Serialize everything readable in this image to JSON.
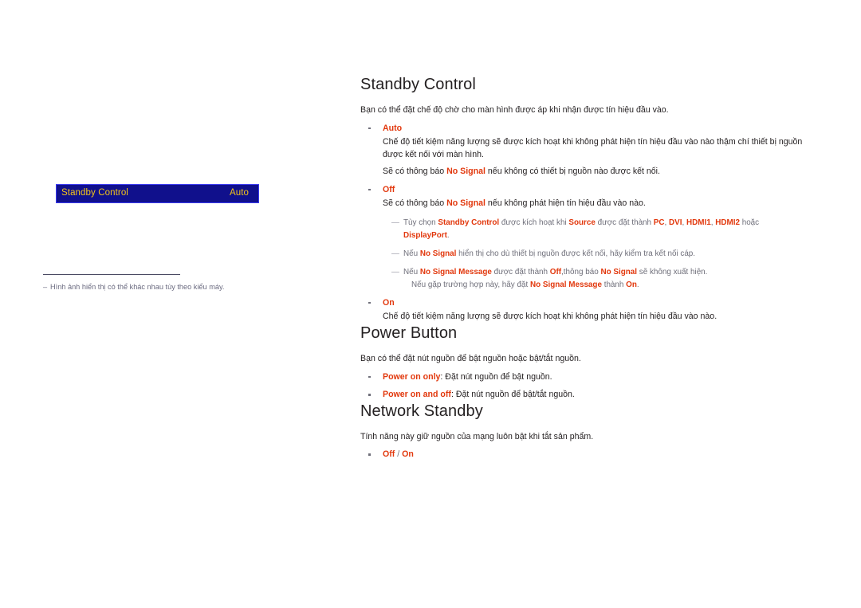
{
  "osd": {
    "label": "Standby Control",
    "value": "Auto",
    "background_color": "#10108c",
    "border_color": "#3a3af0",
    "text_color": "#f5c518"
  },
  "left_footnote": {
    "dash": "–",
    "text": "Hình ảnh hiển thị có thể khác nhau tùy theo kiểu máy."
  },
  "colors": {
    "keyword_red": "#e2380d",
    "body_text": "#231f20",
    "note_gray": "#6f6f7a"
  },
  "sections": {
    "standby_control": {
      "heading": "Standby Control",
      "intro": "Bạn có thể đặt chế độ chờ cho màn hình được áp khi nhận được tín hiệu đầu vào.",
      "auto": {
        "title": "Auto",
        "line1": "Chế độ tiết kiệm năng lượng sẽ được kích hoạt khi không phát hiện tín hiệu đầu vào nào thậm chí thiết bị nguồn được kết nối với màn hình.",
        "line2_pre": "Sẽ có thông báo ",
        "line2_kw": "No Signal",
        "line2_post": " nếu không có thiết bị nguồn nào được kết nối."
      },
      "off": {
        "title": "Off",
        "line1_pre": "Sẽ có thông báo ",
        "line1_kw": "No Signal",
        "line1_post": " nếu không phát hiện tín hiệu đầu vào nào."
      },
      "notes": [
        {
          "dash": "—",
          "p1": "Tùy chọn ",
          "k1": "Standby Control",
          "p2": " được kích hoạt khi ",
          "k2": "Source",
          "p3": " được đặt thành ",
          "k3": "PC",
          "p4": ", ",
          "k4": "DVI",
          "p5": ", ",
          "k5": "HDMI1",
          "p6": ", ",
          "k6": "HDMI2",
          "p7": " hoặc",
          "k7": "DisplayPort",
          "p8": "."
        },
        {
          "dash": "—",
          "p1": "Nếu ",
          "k1": "No Signal",
          "p2": " hiển thị cho dù thiết bị nguồn được kết nối, hãy kiểm tra kết nối cáp."
        },
        {
          "dash": "—",
          "p1": "Nếu ",
          "k1": "No Signal Message",
          "p2": " được đặt thành ",
          "k2": "Off",
          "p3": ",thông báo ",
          "k3": "No Signal",
          "p4": " sẽ không xuất hiện.",
          "l2p1": "Nếu gặp trường hợp này, hãy đặt ",
          "l2k1": "No Signal Message",
          "l2p2": " thành ",
          "l2k2": "On",
          "l2p3": "."
        }
      ],
      "on": {
        "title": "On",
        "line1": "Chế độ tiết kiệm năng lượng sẽ được kích hoạt khi không phát hiện tín hiệu đầu vào nào."
      }
    },
    "power_button": {
      "heading": "Power Button",
      "intro": "Bạn có thể đặt nút nguồn để bật nguồn hoặc bật/tắt nguồn.",
      "options": [
        {
          "title": "Power on only",
          "desc": ": Đặt nút nguồn để bật nguồn."
        },
        {
          "title": "Power on and off",
          "desc": ": Đặt nút nguồn để bật/tắt nguồn."
        }
      ]
    },
    "network_standby": {
      "heading": "Network Standby",
      "intro": "Tính năng này giữ nguồn của mạng luôn bật khi tắt sản phẩm.",
      "option": {
        "off": "Off",
        "sep": " / ",
        "on": "On"
      }
    }
  }
}
